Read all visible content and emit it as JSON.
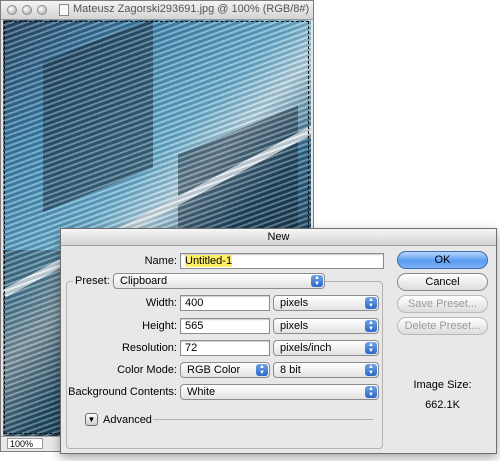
{
  "document_window": {
    "title": "Mateusz Zagorski293691.jpg @ 100% (RGB/8#)",
    "zoom": "100%"
  },
  "dialog": {
    "title": "New",
    "name_label": "Name:",
    "name_value": "Untitled-1",
    "preset_label": "Preset:",
    "preset_value": "Clipboard",
    "width_label": "Width:",
    "width_value": "400",
    "width_unit": "pixels",
    "height_label": "Height:",
    "height_value": "565",
    "height_unit": "pixels",
    "resolution_label": "Resolution:",
    "resolution_value": "72",
    "resolution_unit": "pixels/inch",
    "color_mode_label": "Color Mode:",
    "color_mode_value": "RGB Color",
    "bit_depth_value": "8 bit",
    "background_label": "Background Contents:",
    "background_value": "White",
    "advanced_label": "Advanced",
    "ok_label": "OK",
    "cancel_label": "Cancel",
    "save_preset_label": "Save Preset...",
    "delete_preset_label": "Delete Preset...",
    "image_size_label": "Image Size:",
    "image_size_value": "662.1K"
  },
  "colors": {
    "highlight": "#ffee66",
    "default_button": "#5a9cf0",
    "popup_arrows": "#2a68c8"
  },
  "icons": [
    "close-icon",
    "minimize-icon",
    "zoom-icon",
    "document-icon",
    "popup-arrows-icon",
    "disclosure-triangle-icon"
  ]
}
